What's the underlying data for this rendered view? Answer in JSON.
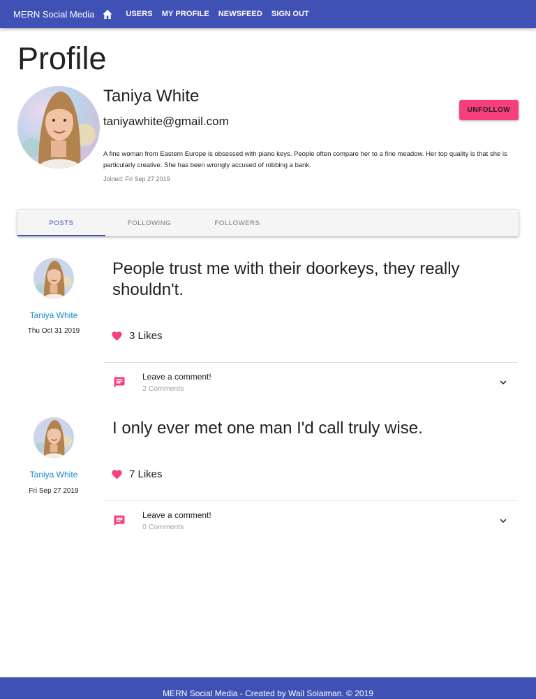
{
  "appbar": {
    "brand": "MERN Social Media",
    "home_icon": "home-icon",
    "nav": [
      {
        "label": "USERS"
      },
      {
        "label": "MY PROFILE"
      },
      {
        "label": "NEWSFEED"
      },
      {
        "label": "SIGN OUT"
      }
    ]
  },
  "profile": {
    "page_title": "Profile",
    "name": "Taniya White",
    "email": "taniyawhite@gmail.com",
    "about": "A fine woman from Eastern Europe is obsessed with piano keys. People often compare her to a fine meadow. Her top quality is that she is particularly creative. She has been wrongly accused of robbing a bank.",
    "joined": "Joined: Fri Sep 27 2019",
    "unfollow_label": "UNFOLLOW"
  },
  "tabs": [
    {
      "label": "POSTS",
      "active": true
    },
    {
      "label": "FOLLOWING",
      "active": false
    },
    {
      "label": "FOLLOWERS",
      "active": false
    }
  ],
  "posts": [
    {
      "author": "Taniya White",
      "date": "Thu Oct 31 2019",
      "text": "People trust me with their doorkeys, they really shouldn't.",
      "likes": "3 Likes",
      "comment_label": "Leave a comment!",
      "comment_count": "2 Comments"
    },
    {
      "author": "Taniya White",
      "date": "Fri Sep 27 2019",
      "text": "I only ever met one man I'd call truly wise.",
      "likes": "7 Likes",
      "comment_label": "Leave a comment!",
      "comment_count": "0 Comments"
    }
  ],
  "footer": {
    "text": "MERN Social Media - Created by Wail Solaiman. © 2019"
  },
  "colors": {
    "primary": "#3f51b5",
    "accent": "#f73e7e",
    "link": "#1a8bc6"
  }
}
